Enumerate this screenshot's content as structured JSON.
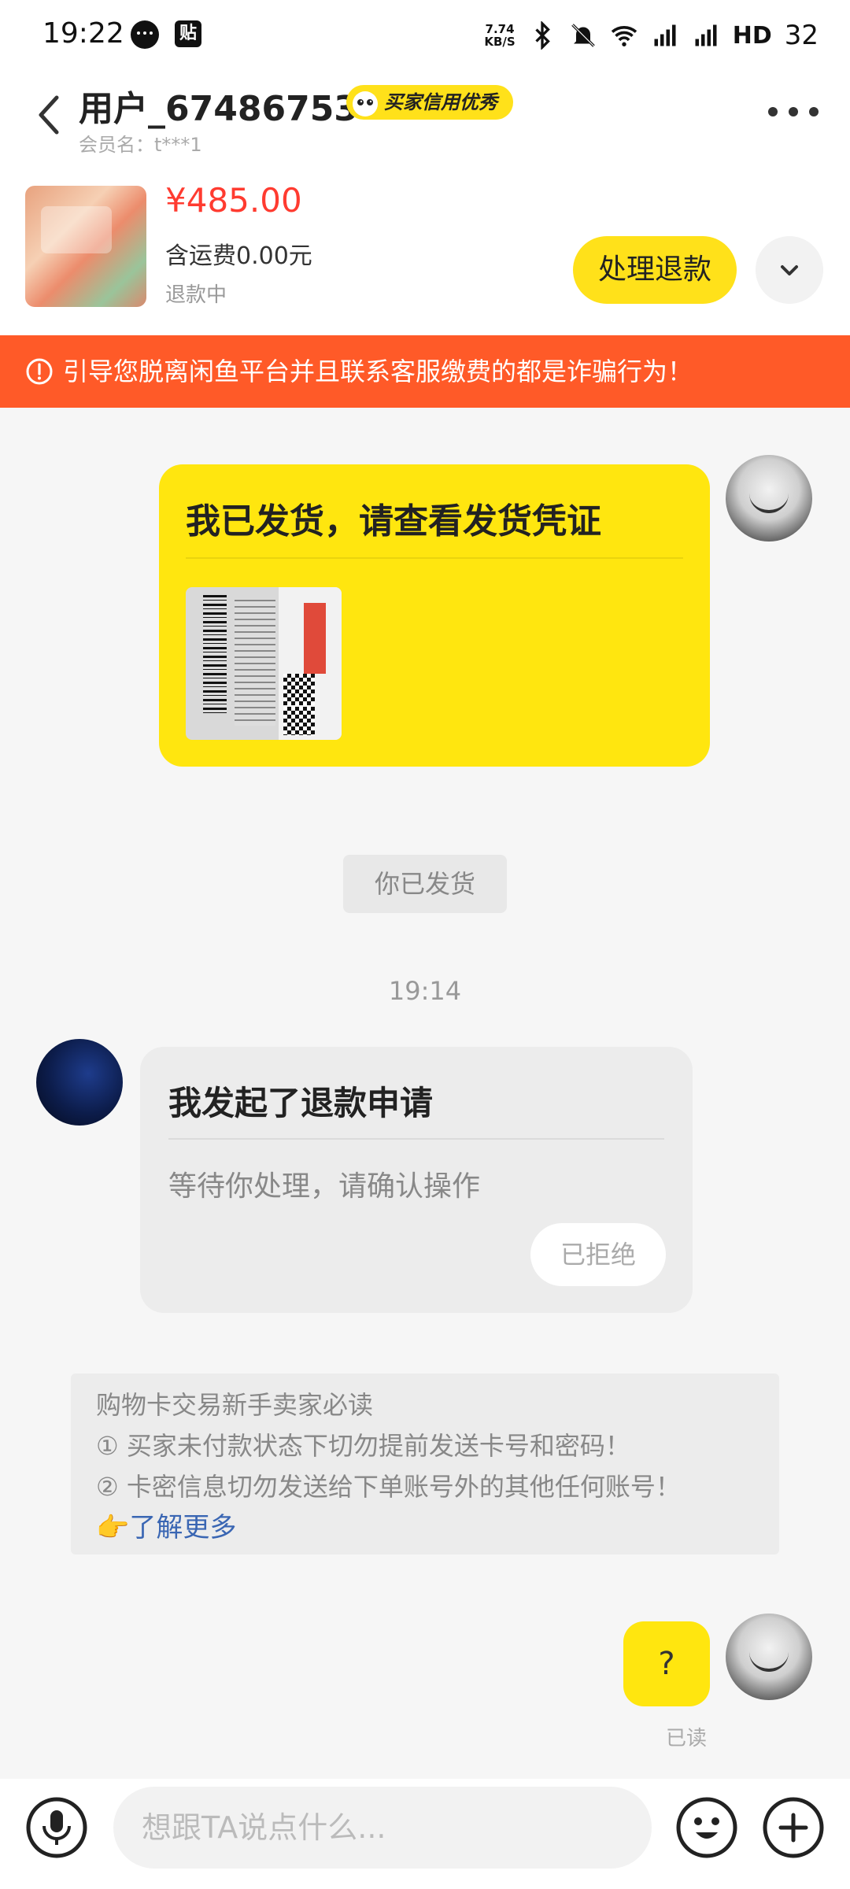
{
  "status_bar": {
    "time": "19:22",
    "notification_icons": [
      "chat-bubble-icon",
      "tie-app-icon"
    ],
    "notif2_label": "贴",
    "net_speed_value": "7.74",
    "net_speed_unit": "KB/S",
    "hd_label": "HD",
    "battery": "32",
    "icons": [
      "bluetooth-icon",
      "muted-bell-icon",
      "wifi-icon",
      "5g-signal-icon",
      "4g-signal-icon"
    ]
  },
  "header": {
    "username": "用户_67486753",
    "credit_badge": "买家信用优秀",
    "member_name": "会员名：t***1",
    "icons": [
      "back-arrow-icon",
      "more-dots-icon"
    ]
  },
  "product": {
    "price": "¥485.00",
    "shipping": "含运费0.00元",
    "status": "退款中",
    "action_button": "处理退款",
    "icons": [
      "chevron-down-icon"
    ]
  },
  "warning": {
    "text": "引导您脱离闲鱼平台并且联系客服缴费的都是诈骗行为！",
    "icon": "exclamation-circle-icon"
  },
  "messages": {
    "shipped_card": {
      "title": "我已发货，请查看发货凭证"
    },
    "system_shipped": "你已发货",
    "timestamp": "19:14",
    "refund_card": {
      "title": "我发起了退款申请",
      "description": "等待你处理，请确认操作",
      "button": "已拒绝"
    },
    "notice": {
      "lines": [
        "购物卡交易新手卖家必读",
        "① 买家未付款状态下切勿提前发送卡号和密码！",
        "② 卡密信息切勿发送给下单账号外的其他任何账号！"
      ],
      "more_emoji": "👉",
      "more_link": "了解更多"
    },
    "question_bubble": "?",
    "read_status": "已读"
  },
  "input_bar": {
    "placeholder": "想跟TA说点什么...",
    "value": "",
    "icons": [
      "microphone-icon",
      "emoji-icon",
      "plus-circle-icon"
    ]
  },
  "colors": {
    "accent_yellow": "#ffe60f",
    "warning_orange": "#ff5a28",
    "price_red": "#ff3b30",
    "link_blue": "#3a66b3"
  }
}
